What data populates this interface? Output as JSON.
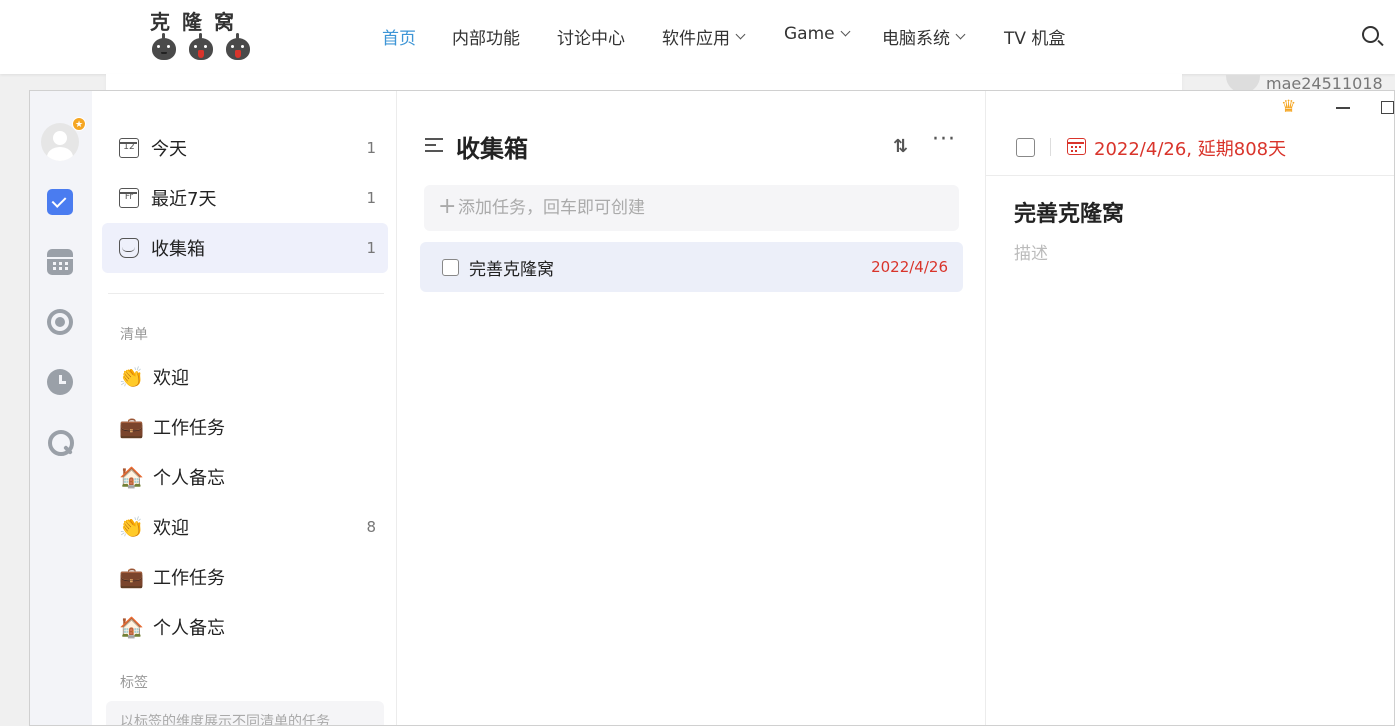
{
  "site": {
    "logo_text": "克隆窝",
    "nav": [
      {
        "label": "首页",
        "active": true,
        "dropdown": false
      },
      {
        "label": "内部功能",
        "active": false,
        "dropdown": false
      },
      {
        "label": "讨论中心",
        "active": false,
        "dropdown": false
      },
      {
        "label": "软件应用",
        "active": false,
        "dropdown": true
      },
      {
        "label": "Game",
        "active": false,
        "dropdown": true
      },
      {
        "label": "电脑系统",
        "active": false,
        "dropdown": true
      },
      {
        "label": "TV 机盒",
        "active": false,
        "dropdown": false
      }
    ],
    "search_icon": "search-icon",
    "username": "mae24511018",
    "accent_color": "#3d95d6"
  },
  "rail": {
    "icons": [
      "avatar",
      "task-checkbox-icon",
      "calendar-grid-icon",
      "focus-target-icon",
      "clock-icon",
      "search-icon"
    ],
    "premium_badge": "★"
  },
  "sidebar": {
    "smart_lists": [
      {
        "label": "今天",
        "count": "1",
        "icon_text": "12",
        "icon": "calendar-today-icon"
      },
      {
        "label": "最近7天",
        "count": "1",
        "icon_text": "Fr",
        "icon": "calendar-week-icon"
      },
      {
        "label": "收集箱",
        "count": "1",
        "icon": "inbox-icon",
        "selected": true
      }
    ],
    "lists_section_label": "清单",
    "lists": [
      {
        "emoji": "👏",
        "label": "欢迎",
        "count": ""
      },
      {
        "emoji": "💼",
        "label": "工作任务",
        "count": ""
      },
      {
        "emoji": "🏠",
        "label": "个人备忘",
        "count": ""
      },
      {
        "emoji": "👏",
        "label": "欢迎",
        "count": "8"
      },
      {
        "emoji": "💼",
        "label": "工作任务",
        "count": ""
      },
      {
        "emoji": "🏠",
        "label": "个人备忘",
        "count": ""
      }
    ],
    "tags_section_label": "标签",
    "tags_hint": "以标签的维度展示不同清单的任务"
  },
  "list": {
    "title": "收集箱",
    "sort_icon": "⇅",
    "more_icon": "···",
    "add_placeholder": "添加任务，回车即可创建",
    "add_plus": "+",
    "tasks": [
      {
        "title": "完善克隆窝",
        "date": "2022/4/26",
        "completed": false
      }
    ]
  },
  "detail": {
    "due_text": "2022/4/26, 延期808天",
    "title": "完善克隆窝",
    "description_placeholder": "描述",
    "crown": "♛",
    "overdue_color": "#d9342b"
  }
}
